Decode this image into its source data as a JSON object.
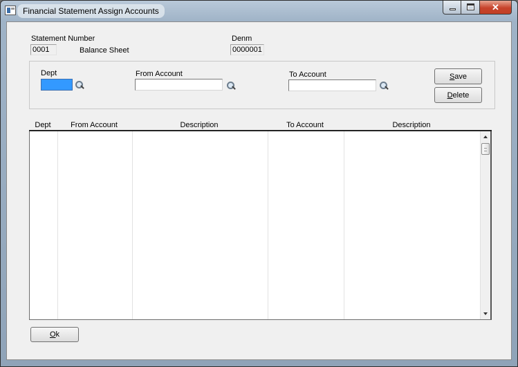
{
  "window": {
    "title": "Financial Statement Assign Accounts",
    "close_glyph": "✕"
  },
  "header": {
    "statement_number_label": "Statement Number",
    "statement_number_value": "0001",
    "statement_name": "Balance Sheet",
    "denm_label": "Denm",
    "denm_value": "0000001"
  },
  "form": {
    "dept_label": "Dept",
    "dept_value": "",
    "from_account_label": "From Account",
    "from_account_value": "",
    "to_account_label": "To Account",
    "to_account_value": "",
    "save_mnemonic": "S",
    "save_rest": "ave",
    "delete_mnemonic": "D",
    "delete_rest": "elete"
  },
  "grid": {
    "columns": [
      "Dept",
      "From Account",
      "Description",
      "To Account",
      "Description"
    ],
    "rows": []
  },
  "footer": {
    "ok_mnemonic": "O",
    "ok_rest": "k"
  },
  "icons": {
    "app": "app-icon",
    "lookup": "magnifier-icon"
  },
  "colors": {
    "selection": "#3399ff",
    "close_button": "#c7432b"
  }
}
